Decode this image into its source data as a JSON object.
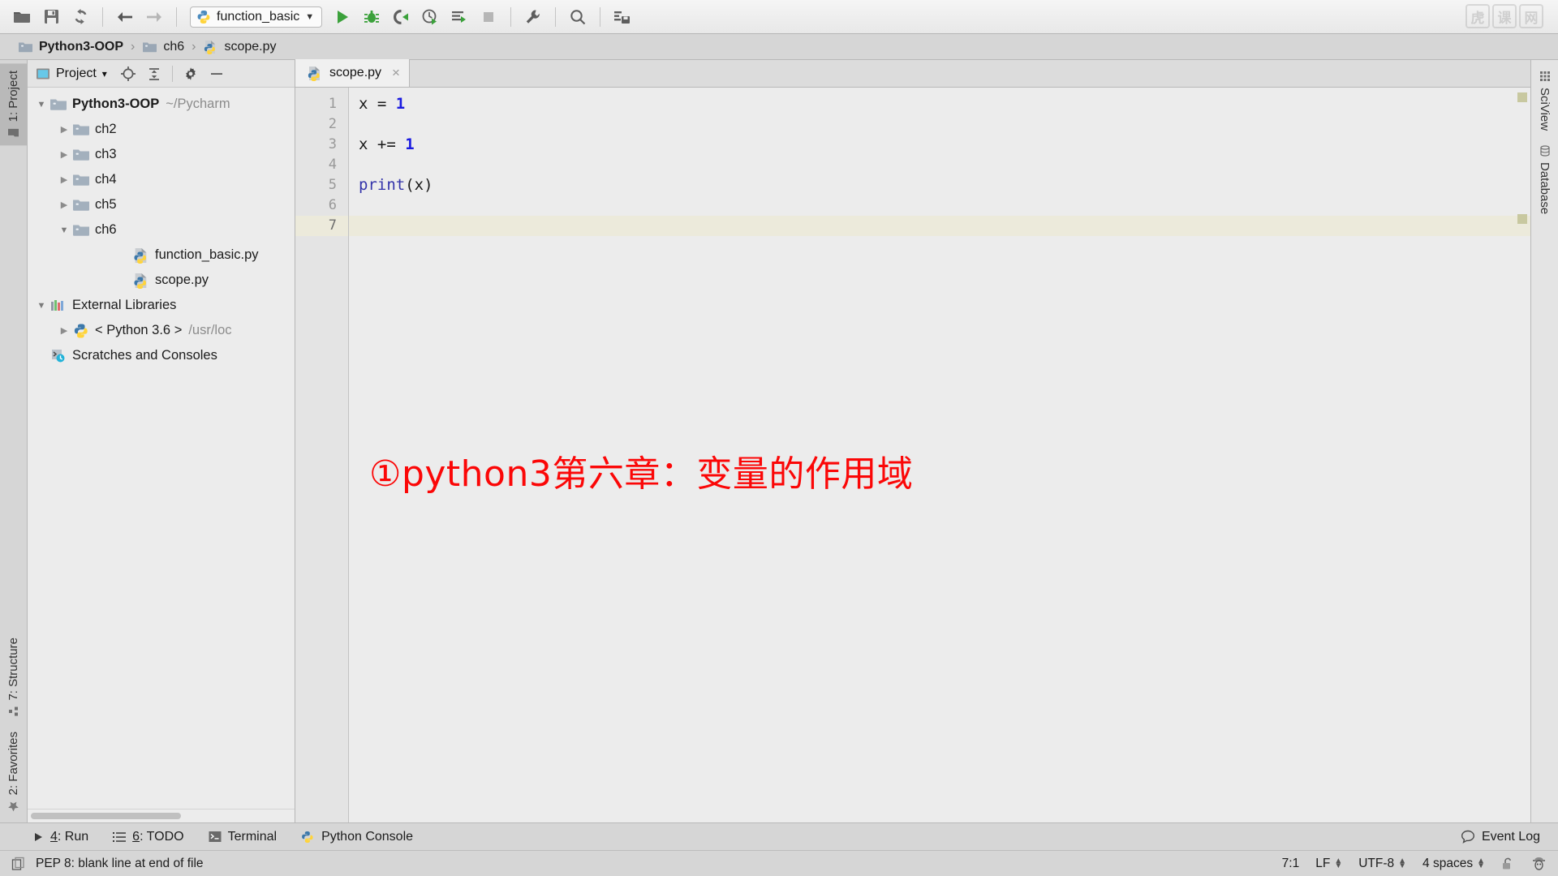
{
  "toolbar": {
    "icons": [
      {
        "name": "open-folder-icon",
        "label": "Open"
      },
      {
        "name": "save-all-icon",
        "label": "Save All"
      },
      {
        "name": "sync-refresh-icon",
        "label": "Synchronize"
      },
      {
        "name": "back-arrow-icon",
        "label": "Back"
      },
      {
        "name": "forward-arrow-icon",
        "label": "Forward"
      }
    ],
    "run_config": {
      "label": "function_basic",
      "icon": "python-file-icon",
      "dropdown": "▼"
    },
    "actions": [
      {
        "name": "run-button",
        "label": "Run"
      },
      {
        "name": "debug-button",
        "label": "Debug"
      },
      {
        "name": "run-coverage-button",
        "label": "Run with Coverage"
      },
      {
        "name": "profile-button",
        "label": "Profile"
      },
      {
        "name": "run-with-console-button",
        "label": "Run with Console"
      },
      {
        "name": "stop-button",
        "label": "Stop"
      },
      {
        "name": "settings-wrench-button",
        "label": "Settings"
      },
      {
        "name": "search-everywhere-button",
        "label": "Search Everywhere"
      },
      {
        "name": "update-project-button",
        "label": "Update Project"
      }
    ],
    "watermark": "虎课网"
  },
  "breadcrumb": {
    "items": [
      {
        "label": "Python3-OOP",
        "icon": "folder-icon",
        "bold": true
      },
      {
        "label": "ch6",
        "icon": "folder-icon",
        "bold": false
      },
      {
        "label": "scope.py",
        "icon": "python-file-icon",
        "bold": false
      }
    ],
    "separator": "›"
  },
  "left_strip": {
    "top": [
      {
        "label": "1: Project",
        "icon": "project-icon",
        "active": true
      }
    ],
    "bottom": [
      {
        "label": "7: Structure",
        "icon": "structure-icon",
        "active": false
      },
      {
        "label": "2: Favorites",
        "icon": "star-icon",
        "active": false
      }
    ]
  },
  "right_strip": {
    "items": [
      {
        "label": "SciView",
        "icon": "grid-icon"
      },
      {
        "label": "Database",
        "icon": "database-icon"
      }
    ]
  },
  "project_panel": {
    "title": "Project",
    "title_caret": "▾",
    "header_buttons": [
      {
        "name": "locate-target-icon",
        "label": "Select Opened File"
      },
      {
        "name": "collapse-all-icon",
        "label": "Collapse All"
      },
      {
        "name": "settings-gear-icon",
        "label": "Settings"
      },
      {
        "name": "hide-panel-icon",
        "label": "Hide"
      }
    ],
    "tree": [
      {
        "twisty": "▼",
        "icon": "folder-icon",
        "label": "Python3-OOP",
        "bold": true,
        "path": "~/Pycharm",
        "indent": 0
      },
      {
        "twisty": "▶",
        "icon": "folder-icon",
        "label": "ch2",
        "bold": false,
        "path": "",
        "indent": 1
      },
      {
        "twisty": "▶",
        "icon": "folder-icon",
        "label": "ch3",
        "bold": false,
        "path": "",
        "indent": 1
      },
      {
        "twisty": "▶",
        "icon": "folder-icon",
        "label": "ch4",
        "bold": false,
        "path": "",
        "indent": 1
      },
      {
        "twisty": "▶",
        "icon": "folder-icon",
        "label": "ch5",
        "bold": false,
        "path": "",
        "indent": 1
      },
      {
        "twisty": "▼",
        "icon": "folder-icon",
        "label": "ch6",
        "bold": false,
        "path": "",
        "indent": 1
      },
      {
        "twisty": "",
        "icon": "python-file-icon",
        "label": "function_basic.py",
        "bold": false,
        "path": "",
        "indent": 2
      },
      {
        "twisty": "",
        "icon": "python-file-icon",
        "label": "scope.py",
        "bold": false,
        "path": "",
        "indent": 2
      },
      {
        "twisty": "▼",
        "icon": "libraries-icon",
        "label": "External Libraries",
        "bold": false,
        "path": "",
        "indent": 0
      },
      {
        "twisty": "▶",
        "icon": "python-sdk-icon",
        "label": "< Python 3.6 >",
        "bold": false,
        "path": "/usr/loc",
        "indent": 1
      },
      {
        "twisty": "",
        "icon": "scratches-icon",
        "label": "Scratches and Consoles",
        "bold": false,
        "path": "",
        "indent": 0
      }
    ]
  },
  "editor": {
    "tabs": [
      {
        "label": "scope.py",
        "icon": "python-file-icon",
        "close": "×",
        "active": true
      }
    ],
    "lines": [
      {
        "num": "1",
        "tokens": [
          {
            "t": "x = ",
            "c": "plain"
          },
          {
            "t": "1",
            "c": "num"
          }
        ],
        "current": false
      },
      {
        "num": "2",
        "tokens": [],
        "current": false
      },
      {
        "num": "3",
        "tokens": [
          {
            "t": "x += ",
            "c": "plain"
          },
          {
            "t": "1",
            "c": "num"
          }
        ],
        "current": false
      },
      {
        "num": "4",
        "tokens": [],
        "current": false
      },
      {
        "num": "5",
        "tokens": [
          {
            "t": "print",
            "c": "fn"
          },
          {
            "t": "(x)",
            "c": "plain"
          }
        ],
        "current": false
      },
      {
        "num": "6",
        "tokens": [],
        "current": false
      },
      {
        "num": "7",
        "tokens": [],
        "current": true
      }
    ],
    "annotation": "①python3第六章：变量的作用域"
  },
  "toolwindow_bar": {
    "items": [
      {
        "num": "4",
        "label": ": Run",
        "icon": "run-triangle-icon"
      },
      {
        "num": "6",
        "label": ": TODO",
        "icon": "todo-list-icon"
      },
      {
        "num": "",
        "label": "Terminal",
        "icon": "terminal-icon"
      },
      {
        "num": "",
        "label": "Python Console",
        "icon": "python-console-icon"
      }
    ],
    "event_log": {
      "label": "Event Log",
      "icon": "balloon-icon"
    }
  },
  "statusbar": {
    "message": "PEP 8: blank line at end of file",
    "message_icon": "copy-icon",
    "caret": "7:1",
    "line_separator": "LF",
    "encoding": "UTF-8",
    "indent": "4 spaces",
    "lock_icon": "unlocked-padlock-icon",
    "inspector_icon": "hector-inspection-icon"
  },
  "colors": {
    "accent_green": "#3ba13b",
    "annotation_red": "#fb0707",
    "number_blue": "#1a1ae0",
    "current_line": "#eceadb",
    "chrome_gray": "#d6d6d6"
  }
}
